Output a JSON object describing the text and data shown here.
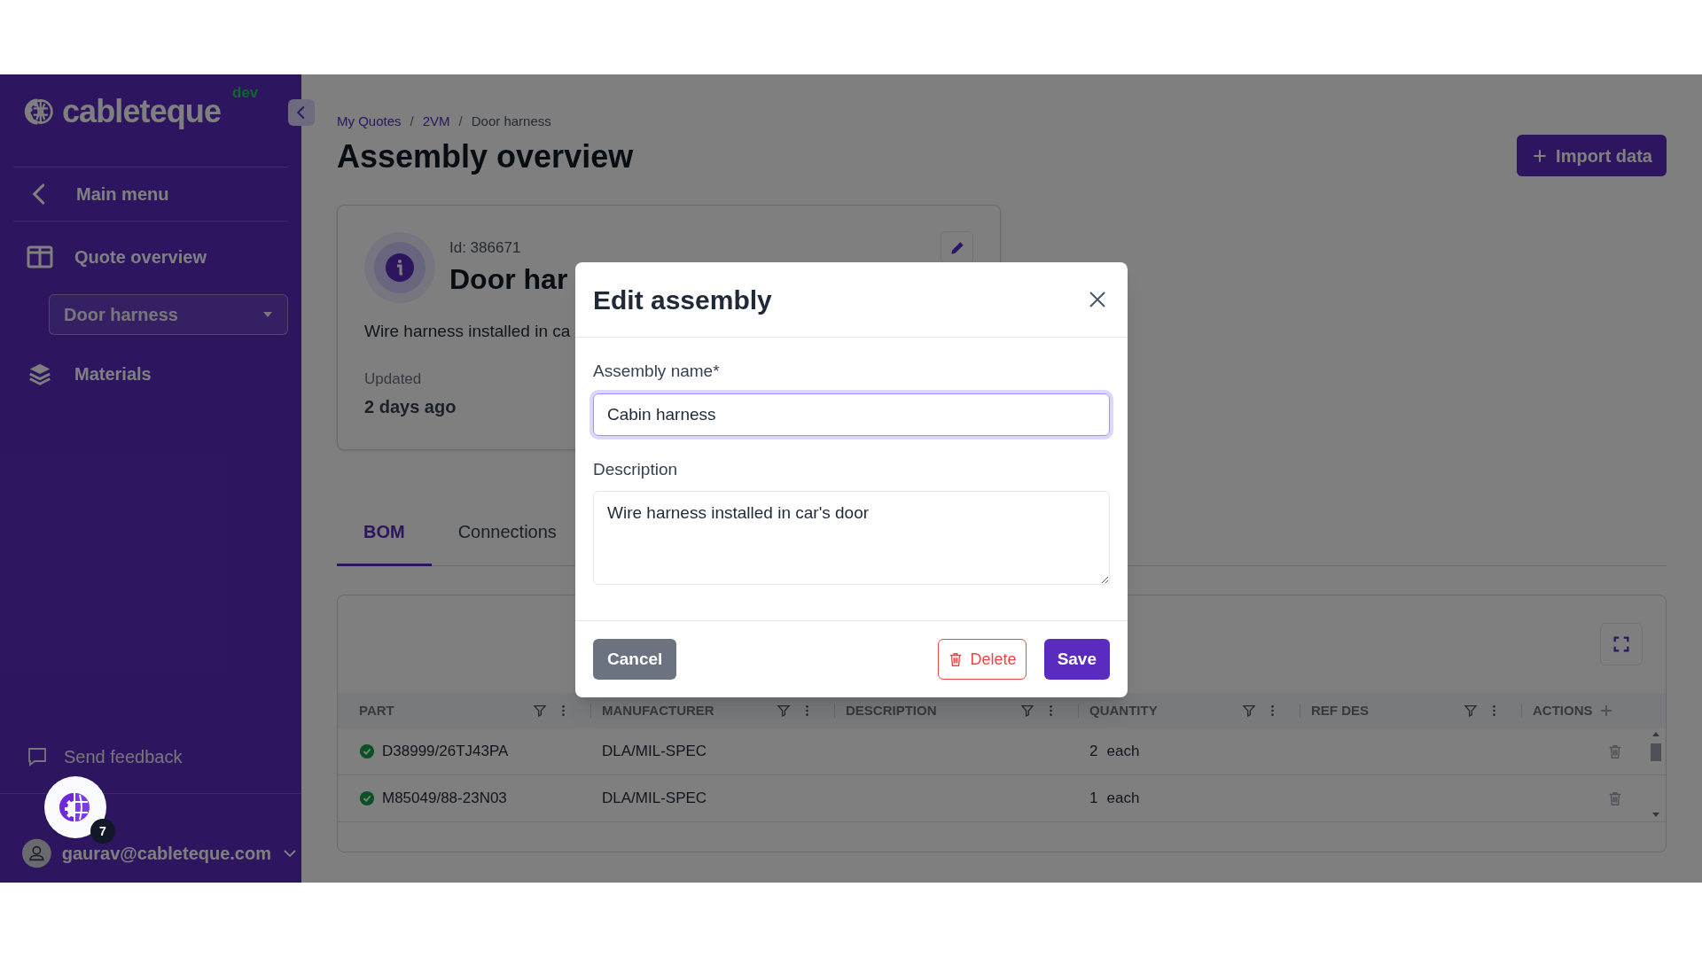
{
  "sidebar": {
    "logo": "cableteque",
    "env_badge": "dev",
    "items": [
      {
        "kind": "back",
        "label": "Main menu"
      },
      {
        "kind": "overview",
        "label": "Quote overview"
      },
      {
        "kind": "select",
        "value": "Door harness"
      },
      {
        "kind": "materials",
        "label": "Materials"
      }
    ],
    "feedback": "Send feedback",
    "user_email": "gaurav@cableteque.com"
  },
  "chat_widget": {
    "badge": "7"
  },
  "breadcrumb": {
    "separator": "/",
    "items": [
      {
        "label": "My Quotes",
        "current": false
      },
      {
        "label": "2VM",
        "current": false
      },
      {
        "label": "Door harness",
        "current": true
      }
    ]
  },
  "page_title": "Assembly overview",
  "import_button": "Import data",
  "assembly_card": {
    "id_label": "Id: 386671",
    "title": "Door har",
    "description": "Wire harness installed in ca",
    "updated_label": "Updated",
    "updated_value": "2 days ago"
  },
  "tabs": [
    {
      "label": "BOM",
      "selected": true
    },
    {
      "label": "Connections",
      "selected": false
    }
  ],
  "table": {
    "columns": [
      {
        "label": "PART",
        "kind": "data"
      },
      {
        "label": "MANUFACTURER",
        "kind": "data"
      },
      {
        "label": "DESCRIPTION",
        "kind": "data"
      },
      {
        "label": "QUANTITY",
        "kind": "data"
      },
      {
        "label": "REF DES",
        "kind": "data"
      },
      {
        "label": "ACTIONS",
        "kind": "actions"
      }
    ],
    "rows": [
      {
        "verified": true,
        "part": "D38999/26TJ43PA",
        "manufacturer": "DLA/MIL-SPEC",
        "quantity": "2",
        "unit": "each"
      },
      {
        "verified": true,
        "part": "M85049/88-23N03",
        "manufacturer": "DLA/MIL-SPEC",
        "quantity": "1",
        "unit": "each"
      }
    ]
  },
  "modal": {
    "title": "Edit assembly",
    "fields": [
      {
        "kind": "input",
        "label": "Assembly name*",
        "value": "Cabin harness",
        "focused": true
      },
      {
        "kind": "textarea",
        "label": "Description",
        "value": "Wire harness installed in car's door",
        "focused": false
      }
    ],
    "buttons": [
      {
        "kind": "secondary",
        "label": "Cancel"
      },
      {
        "kind": "danger",
        "label": "Delete"
      },
      {
        "kind": "primary",
        "label": "Save"
      }
    ]
  }
}
